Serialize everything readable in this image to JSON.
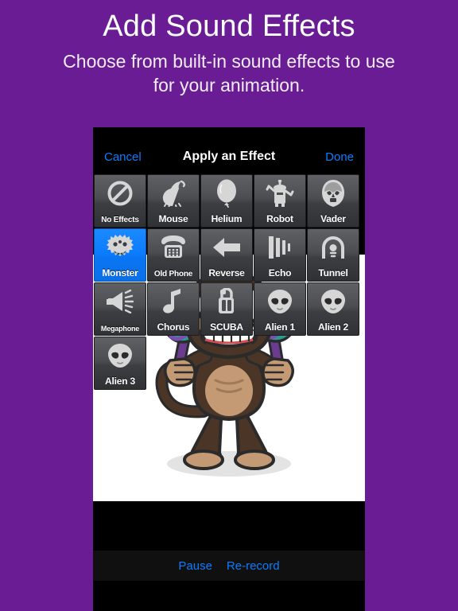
{
  "promo": {
    "title": "Add Sound Effects",
    "subtitle": "Choose from built-in sound effects to use for your animation.",
    "background_color": "#691c93",
    "text_color": "#ffffff"
  },
  "device": {
    "nav_bar": {
      "cancel_label": "Cancel",
      "title": "Apply an Effect",
      "done_label": "Done",
      "tint_color": "#0a7cff",
      "background_color": "#000000"
    },
    "effects_grid": {
      "selected_label": "Monster",
      "selected_color": "#0a7cff",
      "cells": [
        {
          "label": "No Effects",
          "icon": "no-effects-icon",
          "selected": false,
          "label_size": "small"
        },
        {
          "label": "Mouse",
          "icon": "mouse-icon",
          "selected": false,
          "label_size": "normal"
        },
        {
          "label": "Helium",
          "icon": "balloon-icon",
          "selected": false,
          "label_size": "normal"
        },
        {
          "label": "Robot",
          "icon": "robot-icon",
          "selected": false,
          "label_size": "normal"
        },
        {
          "label": "Vader",
          "icon": "vader-helmet-icon",
          "selected": false,
          "label_size": "normal"
        },
        {
          "label": "Monster",
          "icon": "monster-icon",
          "selected": true,
          "label_size": "normal"
        },
        {
          "label": "Old Phone",
          "icon": "rotary-phone-icon",
          "selected": false,
          "label_size": "small"
        },
        {
          "label": "Reverse",
          "icon": "left-arrow-icon",
          "selected": false,
          "label_size": "normal"
        },
        {
          "label": "Echo",
          "icon": "echo-bars-icon",
          "selected": false,
          "label_size": "normal"
        },
        {
          "label": "Tunnel",
          "icon": "tunnel-icon",
          "selected": false,
          "label_size": "normal"
        },
        {
          "label": "Megaphone",
          "icon": "megaphone-icon",
          "selected": false,
          "label_size": "xsmall"
        },
        {
          "label": "Chorus",
          "icon": "music-note-icon",
          "selected": false,
          "label_size": "normal"
        },
        {
          "label": "SCUBA",
          "icon": "scuba-tank-icon",
          "selected": false,
          "label_size": "normal"
        },
        {
          "label": "Alien 1",
          "icon": "alien-head-icon",
          "selected": false,
          "label_size": "normal"
        },
        {
          "label": "Alien 2",
          "icon": "alien-head-icon",
          "selected": false,
          "label_size": "normal"
        },
        {
          "label": "Alien 3",
          "icon": "alien-head-icon",
          "selected": false,
          "label_size": "normal"
        }
      ]
    },
    "canvas": {
      "character": "monkey-with-maracas",
      "background_color": "#ffffff"
    },
    "bottom_toolbar": {
      "pause_label": "Pause",
      "rerecord_label": "Re-record",
      "tint_color": "#0a7cff"
    }
  }
}
